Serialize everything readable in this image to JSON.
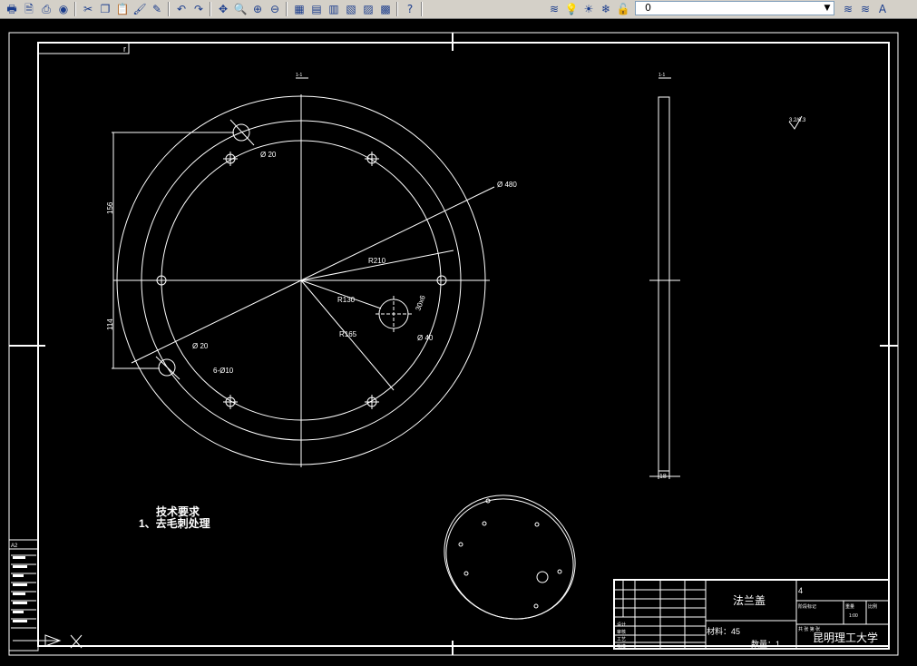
{
  "toolbar": {
    "buttons": [
      {
        "name": "plot-icon",
        "glyph": "🖶"
      },
      {
        "name": "plot-preview-icon",
        "glyph": "🗎"
      },
      {
        "name": "publish-icon",
        "glyph": "⎙"
      },
      {
        "name": "3d-dwf-icon",
        "glyph": "◉"
      },
      {
        "name": "cut-icon",
        "glyph": "✂"
      },
      {
        "name": "copy-icon",
        "glyph": "❐"
      },
      {
        "name": "paste-icon",
        "glyph": "📋"
      },
      {
        "name": "match-properties-icon",
        "glyph": "🖌"
      },
      {
        "name": "block-editor-icon",
        "glyph": "✎"
      },
      {
        "name": "undo-icon",
        "glyph": "↶"
      },
      {
        "name": "redo-icon",
        "glyph": "↷"
      },
      {
        "name": "pan-icon",
        "glyph": "✥"
      },
      {
        "name": "zoom-realtime-icon",
        "glyph": "🔍"
      },
      {
        "name": "zoom-window-icon",
        "glyph": "⊕"
      },
      {
        "name": "zoom-previous-icon",
        "glyph": "⊖"
      },
      {
        "name": "properties-icon",
        "glyph": "▦"
      },
      {
        "name": "design-center-icon",
        "glyph": "▤"
      },
      {
        "name": "tool-palettes-icon",
        "glyph": "▥"
      },
      {
        "name": "sheet-set-icon",
        "glyph": "▧"
      },
      {
        "name": "markup-icon",
        "glyph": "▨"
      },
      {
        "name": "quickcalc-icon",
        "glyph": "▩"
      },
      {
        "name": "help-icon",
        "glyph": "?"
      }
    ],
    "layer_buttons": [
      {
        "name": "layer-manager-icon",
        "glyph": "≋"
      },
      {
        "name": "bulb-on-icon",
        "glyph": "💡"
      },
      {
        "name": "sun-icon",
        "glyph": "☀"
      },
      {
        "name": "freeze-icon",
        "glyph": "❄"
      },
      {
        "name": "lock-icon",
        "glyph": "🔓"
      },
      {
        "name": "layer-color-icon",
        "glyph": "□"
      }
    ],
    "layer_value": "0",
    "right_buttons": [
      {
        "name": "make-layer-current-icon",
        "glyph": "≋"
      },
      {
        "name": "layer-previous-icon",
        "glyph": "≋"
      },
      {
        "name": "text-style-icon",
        "glyph": "A"
      }
    ]
  },
  "drawing": {
    "frame_tag": "r",
    "dims": {
      "dia_small_top": "Ø 20",
      "dia_480": "Ø 480",
      "r210": "R210",
      "dim_156": "156",
      "dim_114": "114",
      "r130": "R130",
      "dim_3096": "30x6",
      "r165": "R165",
      "dia_40": "Ø 40",
      "dia_20_bottom": "Ø 20",
      "hole_6x10": "6-Ø10",
      "dim_18": "18",
      "roughness": "3.2/6.3",
      "section_a": "1-1",
      "section_b": "1-1"
    },
    "notes_title": "技术要求",
    "notes_line1": "1、去毛刺处理",
    "title_block": {
      "part_name": "法兰盖",
      "sheet_no": "4",
      "material": "材料：45",
      "quantity": "数量：1",
      "university": "昆明理工大学",
      "scale": "1:00",
      "design_label": "设计",
      "check_label": "审核",
      "process_label": "工艺",
      "approve_label": "批准",
      "stage_label": "阶段标记",
      "weight_label": "重量",
      "scale_label": "比例",
      "sheet_label": "共 张 第 张"
    },
    "side_table_label": "A2",
    "ucs_label": "X"
  }
}
